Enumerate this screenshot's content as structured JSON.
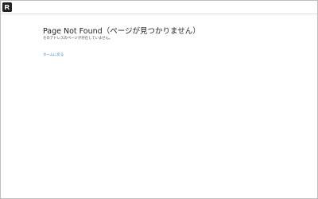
{
  "header": {
    "logo_icon": "site-logo-icon"
  },
  "main": {
    "title": "Page Not Found（ページが見つかりません）",
    "subtitle": "そのアドレスのページが存在していません。",
    "home_link": "ホームに戻る"
  },
  "colors": {
    "link": "#2a8ad8",
    "title": "#222222",
    "border": "#bdbdbd"
  }
}
